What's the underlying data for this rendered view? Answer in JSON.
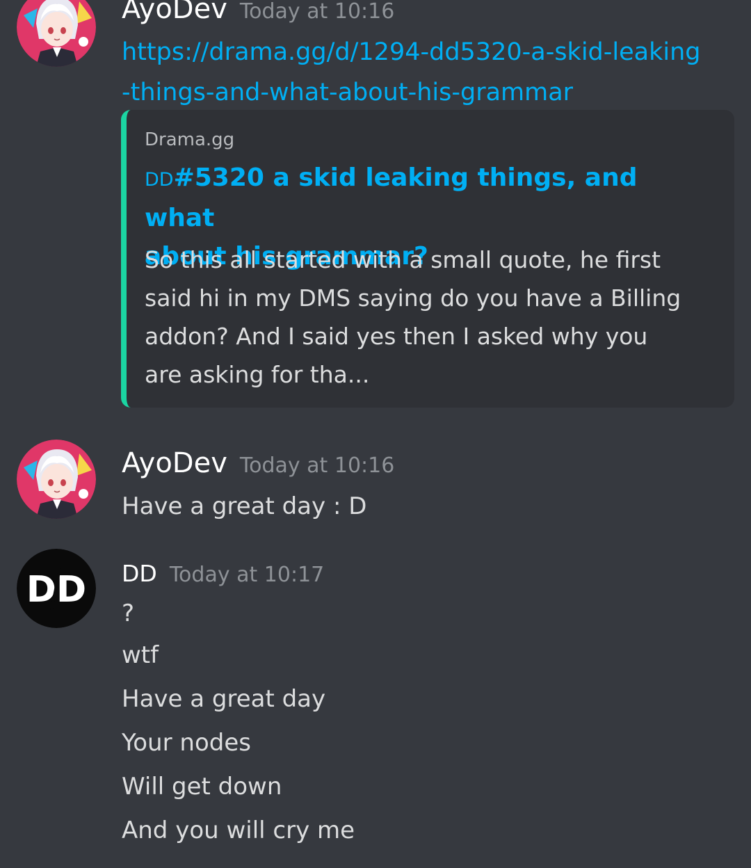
{
  "messages": [
    {
      "author": "AyoDev",
      "timestamp": "Today at 10:16",
      "link_line1": "https://drama.gg/d/1294-dd5320-a-skid-leaking",
      "link_line2": "-things-and-what-about-his-grammar",
      "embed": {
        "provider": "Drama.gg",
        "title_prefix": "DD",
        "title_line1": "#5320 a skid leaking things, and what",
        "title_line2": "about his grammar?",
        "description": [
          "So this all started with a small quote, he first",
          "said hi in my DMS saying do you have a Billing",
          "addon? And I said yes then I asked why you",
          "are asking for tha..."
        ],
        "accent_color": "#1bd5a2"
      }
    },
    {
      "author": "AyoDev",
      "timestamp": "Today at 10:16",
      "lines": [
        "Have a great day : D"
      ]
    },
    {
      "author": "DD",
      "timestamp": "Today at 10:17",
      "avatar_text": "DD",
      "lines": [
        "?",
        "wtf",
        "Have a great day",
        "Your nodes",
        "Will get down",
        "And you will cry me"
      ]
    }
  ],
  "colors": {
    "background": "#36393f",
    "embed_background": "#2f3136",
    "link": "#00aff4",
    "username": "#ffffff",
    "timestamp": "#8e9297",
    "message_text": "#dcddde"
  }
}
